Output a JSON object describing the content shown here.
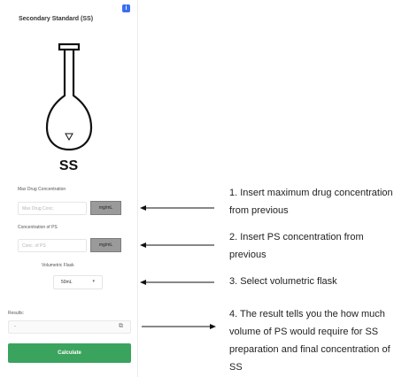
{
  "panel": {
    "title": "Secondary Standard (SS)",
    "flask_label": "SS",
    "info_icon": "i"
  },
  "fields": {
    "max_drug": {
      "label": "Max Drug Concentration",
      "placeholder": "Max Drug Conc.",
      "unit": "mg/mL"
    },
    "ps_conc": {
      "label": "Concentration of PS",
      "placeholder": "Conc. of PS",
      "unit": "mg/mL"
    },
    "flask": {
      "label": "Volumetric Flask",
      "value": "50mL",
      "caret": "▾"
    }
  },
  "results": {
    "label": "Results:",
    "value": "-",
    "copy_icon": "⧉"
  },
  "calculate_button": "Calculate",
  "instructions": [
    "1. Insert maximum drug concentration from previous",
    "2. Insert PS concentration from previous",
    "3. Select volumetric flask",
    "4. The result tells you the how much volume of PS would require for SS preparation and final concentration of SS"
  ],
  "colors": {
    "accent_green": "#3aa35e",
    "unit_gray": "#9a9a9a",
    "info_blue": "#3b6ef0"
  }
}
